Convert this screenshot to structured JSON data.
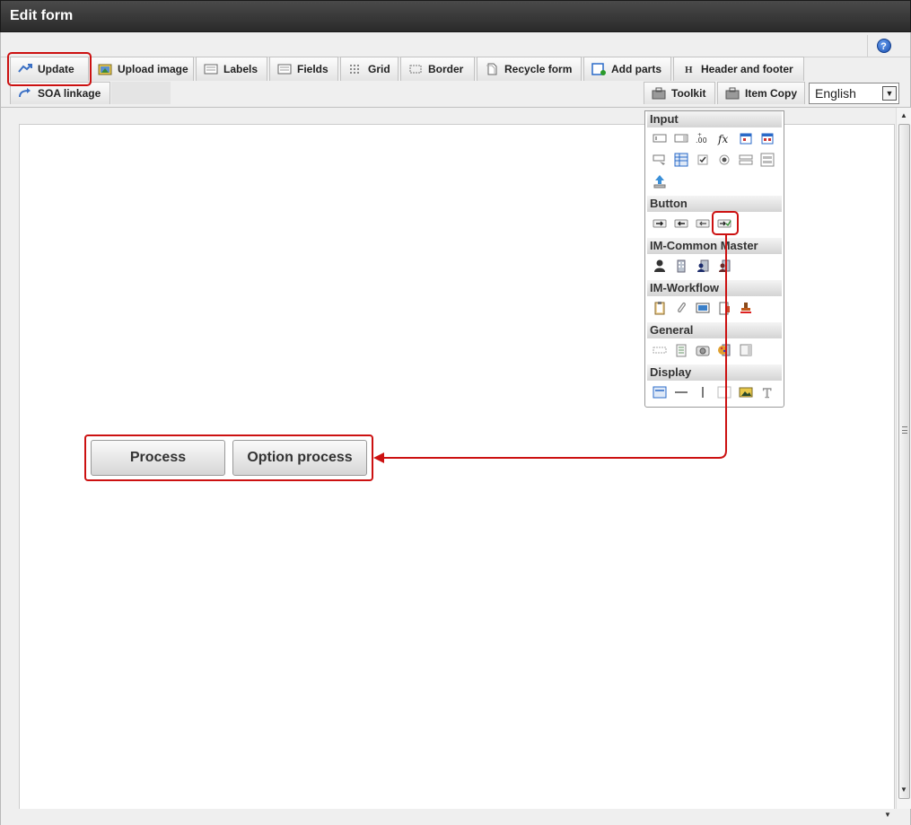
{
  "window": {
    "title": "Edit form"
  },
  "help": {
    "glyph": "?"
  },
  "tabs_row1": [
    {
      "label": "Update",
      "icon": "update-icon"
    },
    {
      "label": "Upload image",
      "icon": "upload-image-icon"
    },
    {
      "label": "Labels",
      "icon": "labels-icon"
    },
    {
      "label": "Fields",
      "icon": "fields-icon"
    },
    {
      "label": "Grid",
      "icon": "grid-icon"
    },
    {
      "label": "Border",
      "icon": "border-icon"
    },
    {
      "label": "Recycle form",
      "icon": "recycle-form-icon"
    },
    {
      "label": "Add parts",
      "icon": "add-parts-icon"
    },
    {
      "label": "Header and footer",
      "icon": "header-footer-icon"
    }
  ],
  "tabs_row2": [
    {
      "label": "SOA linkage",
      "icon": "soa-linkage-icon"
    }
  ],
  "right_tabs": [
    {
      "label": "Toolkit",
      "icon": "toolkit-icon"
    },
    {
      "label": "Item Copy",
      "icon": "item-copy-icon"
    }
  ],
  "language": {
    "selected": "English"
  },
  "palette": {
    "sections": [
      {
        "title": "Input",
        "icons": [
          "textbox-icon",
          "textbox-button-icon",
          "number-field-icon",
          "formula-icon",
          "date-icon",
          "date-range-icon",
          "dropdown-icon",
          "table-icon",
          "checkbox-icon",
          "radio-icon",
          "listbox-icon",
          "list-panel-icon",
          "file-upload-icon"
        ]
      },
      {
        "title": "Button",
        "icons": [
          "next-button-icon",
          "back-button-icon",
          "return-button-icon",
          "process-button-icon"
        ]
      },
      {
        "title": "IM-Common Master",
        "icons": [
          "user-icon",
          "organization-icon",
          "users-icon",
          "company-icon"
        ]
      },
      {
        "title": "IM-Workflow",
        "icons": [
          "clipboard-icon",
          "attachment-icon",
          "image-icon",
          "document-icon",
          "stamp-icon"
        ]
      },
      {
        "title": "General",
        "icons": [
          "hidden-field-icon",
          "note-icon",
          "camera-icon",
          "palette-icon",
          "frame-icon"
        ]
      },
      {
        "title": "Display",
        "icons": [
          "label-icon",
          "horizontal-line-icon",
          "vertical-line-icon",
          "blank-icon",
          "picture-icon",
          "text-icon"
        ]
      }
    ]
  },
  "form_buttons": [
    {
      "label": "Process"
    },
    {
      "label": "Option process"
    }
  ],
  "colors": {
    "highlight": "#cc1111",
    "titlebar": "#333333"
  }
}
